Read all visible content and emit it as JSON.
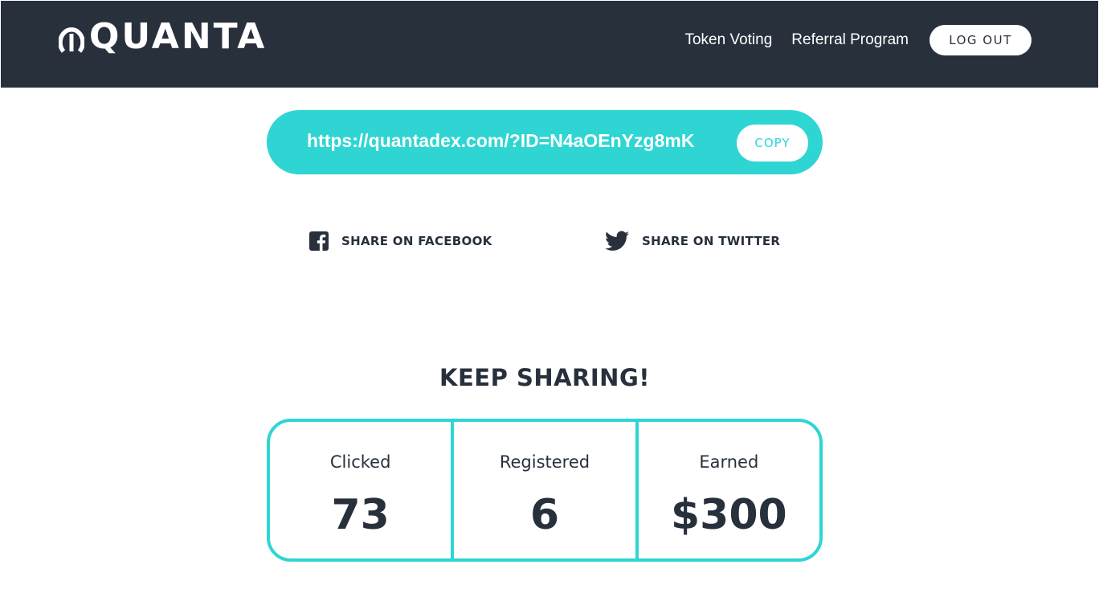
{
  "header": {
    "logo_text": "QUANTA",
    "nav": {
      "token_voting": "Token Voting",
      "referral_program": "Referral Program",
      "logout": "LOG OUT"
    }
  },
  "referral": {
    "url": "https://quantadex.com/?ID=N4aOEnYzg8mK",
    "copy_label": "COPY"
  },
  "share": {
    "facebook_label": "SHARE ON FACEBOOK",
    "twitter_label": "SHARE ON TWITTER"
  },
  "stats": {
    "title": "KEEP SHARING!",
    "clicked_label": "Clicked",
    "clicked_value": "73",
    "registered_label": "Registered",
    "registered_value": "6",
    "earned_label": "Earned",
    "earned_value": "$300"
  },
  "colors": {
    "header_bg": "#28303c",
    "accent": "#2fd5d3",
    "text_dark": "#28303c"
  },
  "icons": {
    "logo": "quanta-logo-icon",
    "facebook": "facebook-icon",
    "twitter": "twitter-icon"
  }
}
